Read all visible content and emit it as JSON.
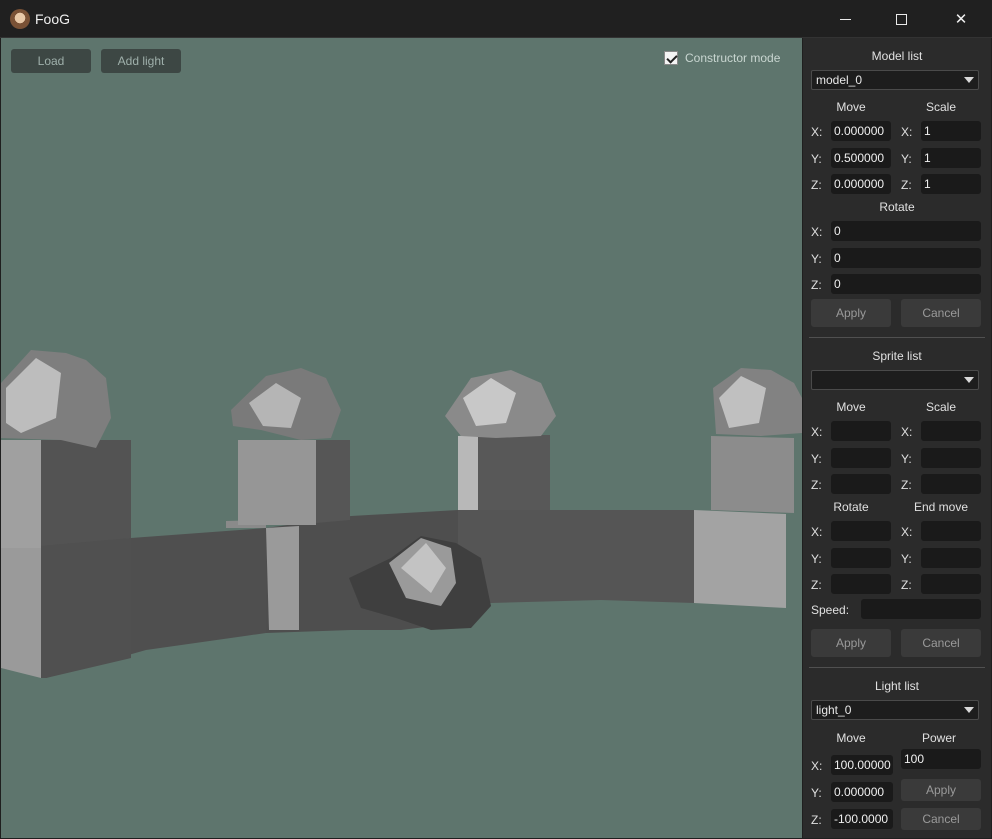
{
  "window": {
    "title": "FooG"
  },
  "viewport": {
    "load_label": "Load",
    "add_light_label": "Add light",
    "constructor_mode_label": "Constructor mode",
    "constructor_mode_checked": true,
    "background_color": "#5e756d"
  },
  "model": {
    "title": "Model list",
    "selected": "model_0",
    "move_label": "Move",
    "scale_label": "Scale",
    "rotate_label": "Rotate",
    "axes": [
      "X:",
      "Y:",
      "Z:"
    ],
    "move": [
      "0.000000",
      "0.500000",
      "0.000000"
    ],
    "scale": [
      "1",
      "1",
      "1"
    ],
    "rotate": [
      "0",
      "0",
      "0"
    ],
    "apply_label": "Apply",
    "cancel_label": "Cancel"
  },
  "sprite": {
    "title": "Sprite list",
    "selected": "",
    "move_label": "Move",
    "scale_label": "Scale",
    "rotate_label": "Rotate",
    "end_move_label": "End move",
    "speed_label": "Speed:",
    "apply_label": "Apply",
    "cancel_label": "Cancel"
  },
  "light": {
    "title": "Light list",
    "selected": "light_0",
    "move_label": "Move",
    "power_label": "Power",
    "move": [
      "100.00000",
      "0.000000",
      "-100.0000"
    ],
    "power": "100",
    "apply_label": "Apply",
    "cancel_label": "Cancel"
  }
}
